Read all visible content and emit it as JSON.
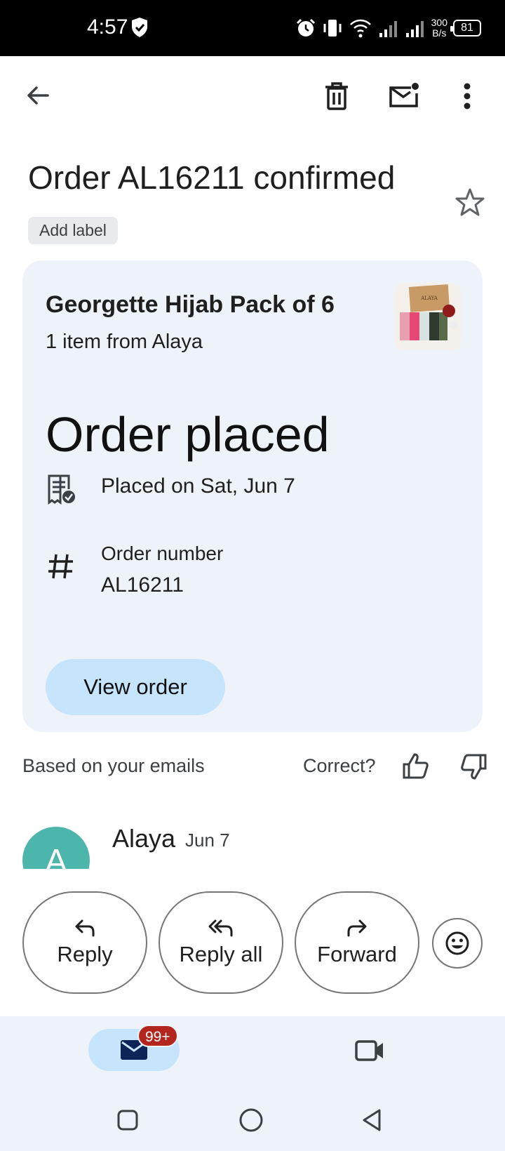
{
  "status_bar": {
    "time": "4:57",
    "net_speed_value": "300",
    "net_speed_unit": "B/s",
    "battery": "81"
  },
  "toolbar": {
    "back_icon": "arrow-left-icon",
    "delete_icon": "trash-icon",
    "mark_unread_icon": "mail-unread-icon",
    "more_icon": "more-vert-icon"
  },
  "email": {
    "subject": "Order AL16211 confirmed",
    "add_label": "Add label",
    "starred": false
  },
  "order_card": {
    "product_title": "Georgette Hijab Pack of 6",
    "product_sub": "1 item from Alaya",
    "thumbnail_brand": "ALAYA",
    "status": "Order placed",
    "placed_on": "Placed on Sat, Jun 7",
    "order_number_label": "Order number",
    "order_number": "AL16211",
    "view_button": "View order",
    "background_color": "#eef2f9",
    "button_color": "#c6e5fc"
  },
  "feedback": {
    "based_on": "Based on your emails",
    "correct": "Correct?"
  },
  "message": {
    "avatar_letter": "A",
    "sender": "Alaya",
    "date": "Jun 7",
    "avatar_color": "#4db6ac"
  },
  "actions": {
    "reply": "Reply",
    "reply_all": "Reply all",
    "forward": "Forward",
    "emoji_icon": "smiley-icon"
  },
  "bottom_nav": {
    "mail_badge": "99+",
    "mail_icon": "mail-icon",
    "meet_icon": "video-camera-icon"
  }
}
